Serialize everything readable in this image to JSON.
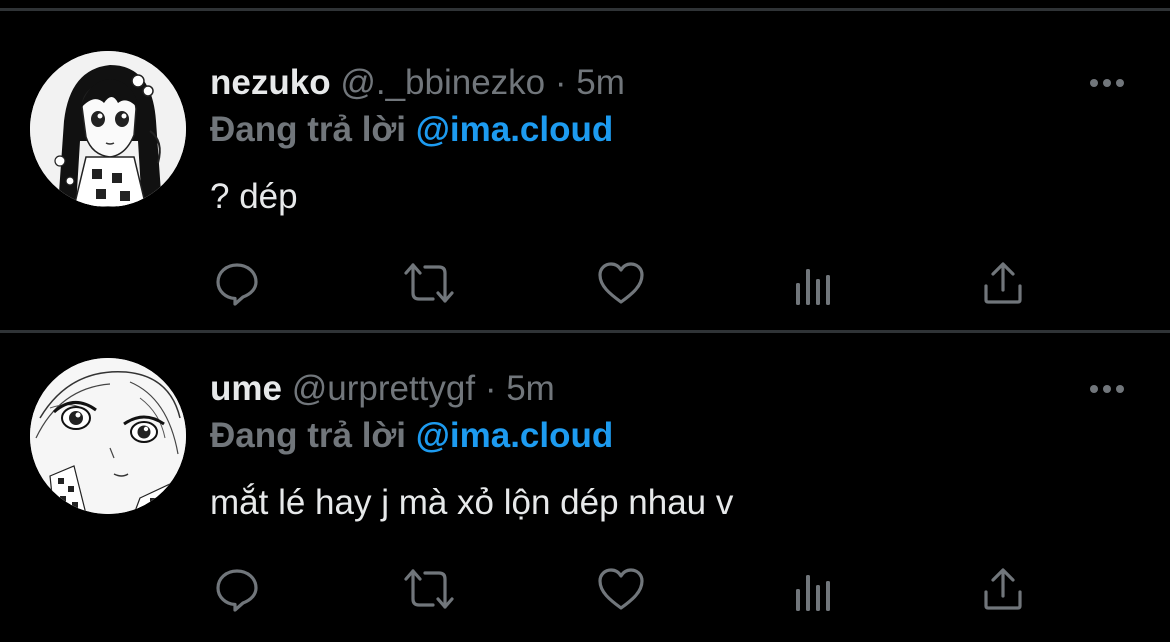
{
  "colors": {
    "background": "#000000",
    "divider": "#2f3336",
    "primary_text": "#e7e9ea",
    "secondary_text": "#71767b",
    "link": "#1d9bf0"
  },
  "icons": {
    "more": "more-horizontal-icon",
    "reply": "reply-bubble-icon",
    "retweet": "retweet-arrows-icon",
    "like": "heart-icon",
    "analytics": "bar-chart-icon",
    "share": "share-upload-icon"
  },
  "tweets": [
    {
      "display_name": "nezuko",
      "handle": "@._bbinezko",
      "separator": "·",
      "time": "5m",
      "reply_prefix": "Đang trả lời",
      "reply_to": "@ima.cloud",
      "text": "? dép"
    },
    {
      "display_name": "ume",
      "handle": "@urprettygf",
      "separator": "·",
      "time": "5m",
      "reply_prefix": "Đang trả lời",
      "reply_to": "@ima.cloud",
      "text": "mắt lé hay j mà xỏ lộn dép nhau v"
    }
  ]
}
